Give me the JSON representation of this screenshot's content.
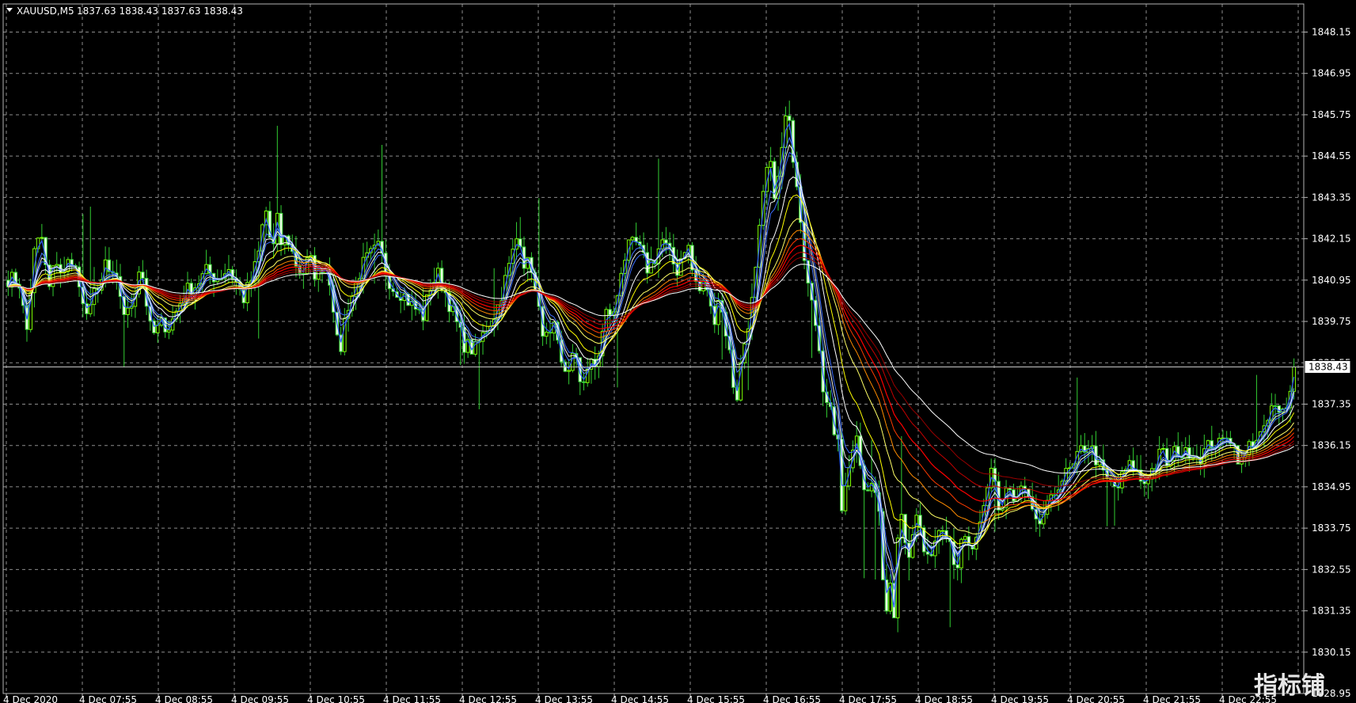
{
  "header": {
    "symbol": "XAUUSD,M5",
    "quote": "1837.63 1838.43 1837.63 1838.43"
  },
  "watermark": "指标铺",
  "colors": {
    "background": "#000000",
    "grid": "#8c8c8c",
    "bull": "#7CFC00",
    "bear": "#e8ffe0",
    "wick": "#32cd32",
    "axis_text": "#ffffff",
    "price_line": "#c8c8c8"
  },
  "chart_data": {
    "type": "candlestick",
    "symbol": "XAUUSD",
    "timeframe": "M5",
    "current_price": "1838.43",
    "y_ticks": [
      "1848.15",
      "1846.95",
      "1845.75",
      "1844.55",
      "1843.35",
      "1842.15",
      "1840.95",
      "1839.75",
      "1838.55",
      "1837.35",
      "1836.15",
      "1834.95",
      "1833.75",
      "1832.55",
      "1831.35",
      "1830.15",
      "1828.95"
    ],
    "ylim": [
      1828.6,
      1848.6
    ],
    "x_ticks": [
      "4 Dec 2020",
      "4 Dec 07:55",
      "4 Dec 08:55",
      "4 Dec 09:55",
      "4 Dec 10:55",
      "4 Dec 11:55",
      "4 Dec 12:55",
      "4 Dec 13:55",
      "4 Dec 14:55",
      "4 Dec 15:55",
      "4 Dec 16:55",
      "4 Dec 17:55",
      "4 Dec 18:55",
      "4 Dec 19:55",
      "4 Dec 20:55",
      "4 Dec 21:55",
      "4 Dec 22:55"
    ],
    "grid": true,
    "path": [
      [
        0,
        1841.0
      ],
      [
        6,
        1840.9
      ],
      [
        10,
        1839.4
      ],
      [
        14,
        1841.7
      ],
      [
        18,
        1842.3
      ],
      [
        22,
        1840.6
      ],
      [
        26,
        1841.6
      ],
      [
        30,
        1841.0
      ],
      [
        34,
        1841.7
      ],
      [
        38,
        1841.0
      ],
      [
        42,
        1839.6
      ],
      [
        46,
        1840.8
      ],
      [
        50,
        1840.3
      ],
      [
        52,
        1841.6
      ],
      [
        56,
        1841.0
      ],
      [
        60,
        1840.8
      ],
      [
        64,
        1839.8
      ],
      [
        68,
        1840.4
      ],
      [
        72,
        1841.5
      ],
      [
        78,
        1839.3
      ],
      [
        84,
        1839.7
      ],
      [
        88,
        1839.6
      ],
      [
        96,
        1840.6
      ],
      [
        102,
        1840.8
      ],
      [
        108,
        1841.2
      ],
      [
        114,
        1841.0
      ],
      [
        120,
        1841.3
      ],
      [
        124,
        1840.9
      ],
      [
        128,
        1840.4
      ],
      [
        132,
        1840.9
      ],
      [
        136,
        1841.6
      ],
      [
        140,
        1843.1
      ],
      [
        144,
        1841.6
      ],
      [
        146,
        1842.9
      ],
      [
        148,
        1842.0
      ],
      [
        152,
        1842.2
      ],
      [
        156,
        1841.5
      ],
      [
        160,
        1841.1
      ],
      [
        164,
        1841.6
      ],
      [
        168,
        1841.0
      ],
      [
        172,
        1841.5
      ],
      [
        176,
        1840.8
      ],
      [
        180,
        1838.6
      ],
      [
        184,
        1840.1
      ],
      [
        188,
        1840.6
      ],
      [
        192,
        1841.3
      ],
      [
        196,
        1841.6
      ],
      [
        202,
        1841.9
      ],
      [
        206,
        1841.1
      ],
      [
        210,
        1840.7
      ],
      [
        214,
        1840.6
      ],
      [
        220,
        1840.2
      ],
      [
        226,
        1839.9
      ],
      [
        230,
        1840.8
      ],
      [
        234,
        1841.1
      ],
      [
        238,
        1840.6
      ],
      [
        242,
        1840.0
      ],
      [
        248,
        1839.1
      ],
      [
        254,
        1838.9
      ],
      [
        260,
        1839.5
      ],
      [
        266,
        1840.1
      ],
      [
        272,
        1841.2
      ],
      [
        278,
        1842.4
      ],
      [
        282,
        1841.1
      ],
      [
        284,
        1841.8
      ],
      [
        286,
        1840.8
      ],
      [
        290,
        1839.7
      ],
      [
        294,
        1839.1
      ],
      [
        298,
        1839.6
      ],
      [
        300,
        1838.5
      ],
      [
        304,
        1838.3
      ],
      [
        308,
        1838.8
      ],
      [
        312,
        1837.9
      ],
      [
        316,
        1838.5
      ],
      [
        320,
        1838.4
      ],
      [
        326,
        1840.1
      ],
      [
        330,
        1839.9
      ],
      [
        334,
        1841.4
      ],
      [
        338,
        1841.9
      ],
      [
        342,
        1842.0
      ],
      [
        348,
        1841.3
      ],
      [
        352,
        1841.6
      ],
      [
        356,
        1842.1
      ],
      [
        360,
        1841.7
      ],
      [
        364,
        1841.2
      ],
      [
        368,
        1841.9
      ],
      [
        370,
        1842.0
      ],
      [
        372,
        1841.3
      ],
      [
        376,
        1840.6
      ],
      [
        380,
        1840.9
      ],
      [
        384,
        1839.6
      ],
      [
        386,
        1840.6
      ],
      [
        390,
        1839.7
      ],
      [
        394,
        1838.4
      ],
      [
        396,
        1837.2
      ],
      [
        398,
        1838.2
      ],
      [
        402,
        1839.5
      ],
      [
        406,
        1840.6
      ],
      [
        410,
        1842.9
      ],
      [
        414,
        1844.5
      ],
      [
        418,
        1843.3
      ],
      [
        422,
        1845.1
      ],
      [
        424,
        1845.9
      ],
      [
        426,
        1845.1
      ],
      [
        430,
        1843.6
      ],
      [
        434,
        1841.4
      ],
      [
        438,
        1840.5
      ],
      [
        440,
        1839.3
      ],
      [
        444,
        1837.7
      ],
      [
        448,
        1837.4
      ],
      [
        450,
        1836.2
      ],
      [
        452,
        1836.5
      ],
      [
        454,
        1834.0
      ],
      [
        458,
        1835.6
      ],
      [
        462,
        1836.3
      ],
      [
        466,
        1834.9
      ],
      [
        470,
        1835.2
      ],
      [
        474,
        1834.1
      ],
      [
        478,
        1831.0
      ],
      [
        480,
        1832.3
      ],
      [
        482,
        1831.0
      ],
      [
        484,
        1833.5
      ],
      [
        486,
        1834.2
      ],
      [
        490,
        1833.0
      ],
      [
        494,
        1834.1
      ],
      [
        496,
        1833.9
      ],
      [
        500,
        1832.6
      ],
      [
        502,
        1833.1
      ],
      [
        504,
        1833.3
      ],
      [
        508,
        1834.0
      ],
      [
        512,
        1833.6
      ],
      [
        516,
        1832.6
      ],
      [
        518,
        1832.9
      ],
      [
        520,
        1833.6
      ],
      [
        522,
        1833.1
      ],
      [
        526,
        1833.2
      ],
      [
        528,
        1833.4
      ],
      [
        532,
        1834.5
      ],
      [
        536,
        1835.7
      ],
      [
        540,
        1834.0
      ],
      [
        544,
        1835.1
      ],
      [
        548,
        1834.3
      ],
      [
        552,
        1835.0
      ],
      [
        556,
        1834.4
      ],
      [
        560,
        1833.7
      ],
      [
        564,
        1834.2
      ],
      [
        568,
        1834.5
      ],
      [
        572,
        1835.1
      ],
      [
        576,
        1835.3
      ],
      [
        580,
        1835.5
      ],
      [
        584,
        1836.0
      ],
      [
        588,
        1836.2
      ],
      [
        592,
        1835.8
      ],
      [
        596,
        1835.3
      ],
      [
        600,
        1835.0
      ],
      [
        604,
        1834.9
      ],
      [
        608,
        1835.4
      ],
      [
        612,
        1835.6
      ],
      [
        616,
        1835.2
      ],
      [
        618,
        1835.0
      ],
      [
        620,
        1835.3
      ],
      [
        624,
        1835.5
      ],
      [
        628,
        1836.0
      ],
      [
        632,
        1835.5
      ],
      [
        636,
        1836.1
      ],
      [
        640,
        1835.8
      ],
      [
        644,
        1836.1
      ],
      [
        648,
        1835.8
      ],
      [
        652,
        1836.0
      ],
      [
        656,
        1836.3
      ],
      [
        660,
        1836.1
      ],
      [
        664,
        1836.6
      ],
      [
        668,
        1836.0
      ],
      [
        672,
        1835.6
      ],
      [
        676,
        1836.2
      ],
      [
        680,
        1836.4
      ],
      [
        684,
        1836.5
      ],
      [
        688,
        1837.3
      ],
      [
        692,
        1837.0
      ],
      [
        696,
        1837.2
      ],
      [
        699,
        1838.3
      ],
      [
        700,
        1838.43
      ]
    ],
    "indicator_lines": [
      {
        "color": "#2f5bff",
        "width": 1.2,
        "period": 2
      },
      {
        "color": "#4a78ff",
        "width": 1,
        "period": 4
      },
      {
        "color": "#3a6dff",
        "width": 1,
        "period": 6
      },
      {
        "color": "#f0f0f0",
        "width": 1,
        "period": 5
      },
      {
        "color": "#ffffff",
        "width": 1,
        "period": 10
      },
      {
        "color": "#ffff00",
        "width": 1,
        "period": 14
      },
      {
        "color": "#ffff66",
        "width": 1,
        "period": 22
      },
      {
        "color": "#ff8c00",
        "width": 1,
        "period": 28
      },
      {
        "color": "#ff3b00",
        "width": 1,
        "period": 34
      },
      {
        "color": "#ff0000",
        "width": 1.2,
        "period": 40
      },
      {
        "color": "#c80000",
        "width": 1,
        "period": 48
      },
      {
        "color": "#990000",
        "width": 1,
        "period": 56
      },
      {
        "color": "#ffffff",
        "width": 1,
        "period": 70
      }
    ]
  }
}
